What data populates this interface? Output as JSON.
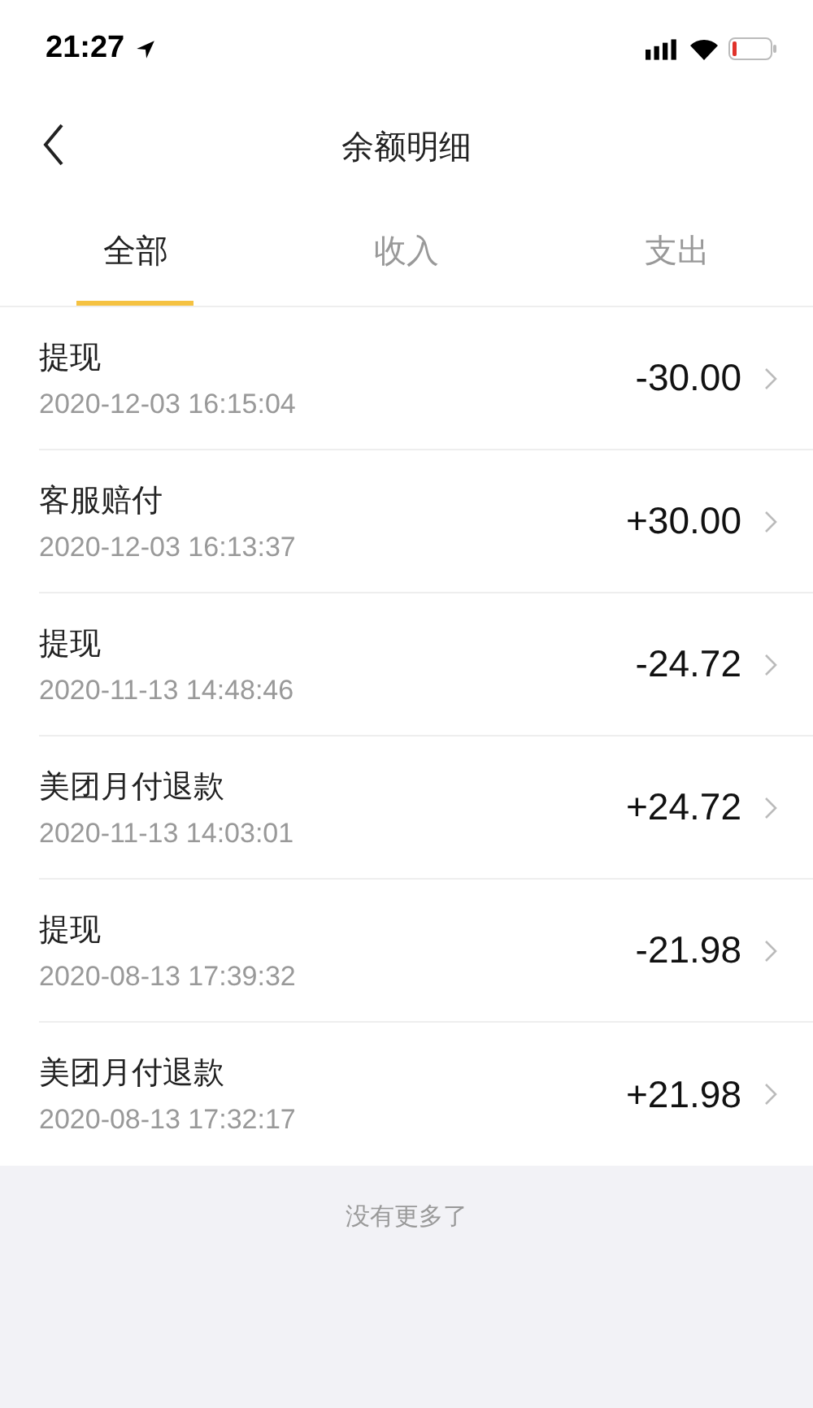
{
  "status_bar": {
    "time": "21:27"
  },
  "nav": {
    "title": "余额明细"
  },
  "tabs": [
    {
      "label": "全部",
      "selected": true
    },
    {
      "label": "收入",
      "selected": false
    },
    {
      "label": "支出",
      "selected": false
    }
  ],
  "records": [
    {
      "name": "提现",
      "time": "2020-12-03 16:15:04",
      "amount": "-30.00"
    },
    {
      "name": "客服赔付",
      "time": "2020-12-03 16:13:37",
      "amount": "+30.00"
    },
    {
      "name": "提现",
      "time": "2020-11-13 14:48:46",
      "amount": "-24.72"
    },
    {
      "name": "美团月付退款",
      "time": "2020-11-13 14:03:01",
      "amount": "+24.72"
    },
    {
      "name": "提现",
      "time": "2020-08-13 17:39:32",
      "amount": "-21.98"
    },
    {
      "name": "美团月付退款",
      "time": "2020-08-13 17:32:17",
      "amount": "+21.98"
    }
  ],
  "footer": {
    "text": "没有更多了"
  }
}
